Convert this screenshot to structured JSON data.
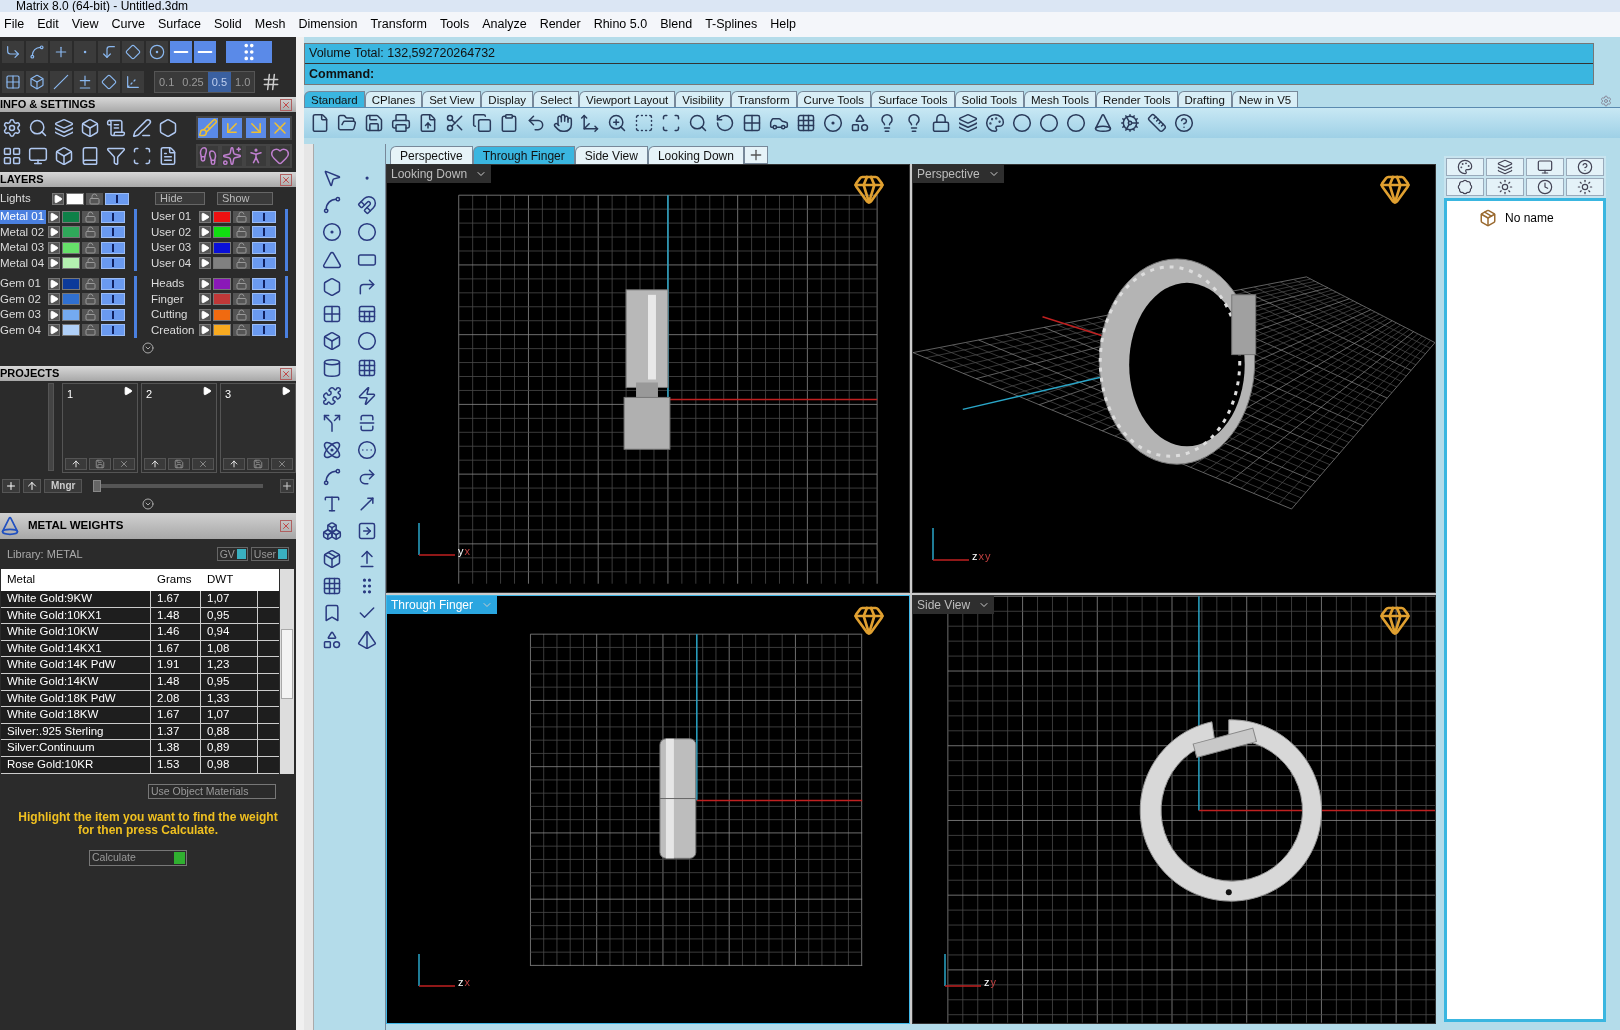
{
  "window": {
    "title": "Matrix 8.0 (64-bit) - Untitled.3dm"
  },
  "menu": [
    "File",
    "Edit",
    "View",
    "Curve",
    "Surface",
    "Solid",
    "Mesh",
    "Dimension",
    "Transform",
    "Tools",
    "Analyze",
    "Render",
    "Rhino 5.0",
    "Blend",
    "T-Splines",
    "Help"
  ],
  "snaps": {
    "grid_steps": [
      {
        "label": "0.1",
        "selected": false
      },
      {
        "label": "0.25",
        "selected": false
      },
      {
        "label": "0.5",
        "selected": true
      },
      {
        "label": "1.0",
        "selected": false
      }
    ]
  },
  "info_settings": {
    "title": "INFO & SETTINGS"
  },
  "layers": {
    "title": "LAYERS",
    "lights": {
      "name": "Lights",
      "color": "#ffffff",
      "visible": true
    },
    "hide": "Hide",
    "show": "Show",
    "groups": [
      [
        {
          "name": "Metal 01",
          "color": "#0e8048",
          "selected": true,
          "visible": true
        },
        {
          "name": "Metal 02",
          "color": "#2fa85a",
          "selected": false,
          "visible": true
        },
        {
          "name": "Metal 03",
          "color": "#66e06a",
          "selected": false,
          "visible": true
        },
        {
          "name": "Metal 04",
          "color": "#b4f0b0",
          "selected": false,
          "visible": true
        }
      ],
      [
        {
          "name": "User 01",
          "color": "#ee1111",
          "selected": false,
          "visible": true
        },
        {
          "name": "User 02",
          "color": "#11dd11",
          "selected": false,
          "visible": true
        },
        {
          "name": "User 03",
          "color": "#0a10d8",
          "selected": false,
          "visible": true
        },
        {
          "name": "User 04",
          "color": "#808080",
          "selected": false,
          "visible": true
        }
      ],
      [
        {
          "name": "Gem 01",
          "color": "#0c3a9a",
          "selected": false,
          "visible": true
        },
        {
          "name": "Gem 02",
          "color": "#3070d0",
          "selected": false,
          "visible": true
        },
        {
          "name": "Gem 03",
          "color": "#74aaf0",
          "selected": false,
          "visible": true
        },
        {
          "name": "Gem 04",
          "color": "#b0d0f8",
          "selected": false,
          "visible": true
        }
      ],
      [
        {
          "name": "Heads",
          "color": "#8a18b8",
          "selected": false,
          "visible": true
        },
        {
          "name": "Finger",
          "color": "#c03838",
          "selected": false,
          "visible": true
        },
        {
          "name": "Cutting",
          "color": "#f06a10",
          "selected": false,
          "visible": true
        },
        {
          "name": "Creation",
          "color": "#f8aa20",
          "selected": false,
          "visible": true
        }
      ]
    ]
  },
  "projects": {
    "title": "PROJECTS",
    "slots": [
      "1",
      "2",
      "3"
    ],
    "manager": "Mngr",
    "slider": {
      "level": 0
    }
  },
  "metal_weights": {
    "title": "METAL WEIGHTS",
    "library": "Library: METAL",
    "toggles": [
      "GV",
      "User"
    ],
    "columns": [
      "Metal",
      "Grams",
      "DWT"
    ],
    "rows": [
      [
        "White Gold:9KW",
        "1.67",
        "1,07"
      ],
      [
        "White Gold:10KX1",
        "1.48",
        "0,95"
      ],
      [
        "White Gold:10KW",
        "1.46",
        "0,94"
      ],
      [
        "White Gold:14KX1",
        "1.67",
        "1,08"
      ],
      [
        "White Gold:14K PdW",
        "1.91",
        "1,23"
      ],
      [
        "White Gold:14KW",
        "1.48",
        "0,95"
      ],
      [
        "White Gold:18K PdW",
        "2.08",
        "1,33"
      ],
      [
        "White Gold:18KW",
        "1.67",
        "1,07"
      ],
      [
        "Silver:.925 Sterling",
        "1.37",
        "0,88"
      ],
      [
        "Silver:Continuum",
        "1.38",
        "0,89"
      ],
      [
        "Rose Gold:10KR",
        "1.53",
        "0,98"
      ]
    ],
    "use_object_materials": "Use Object Materials",
    "hint": "Highlight the item you want to find the weight for then press Calculate.",
    "calculate": "Calculate"
  },
  "command": {
    "volume": "Volume Total: 132,592720264732",
    "prompt": "Command:"
  },
  "toolbar_tabs": [
    {
      "label": "Standard",
      "selected": true
    },
    {
      "label": "CPlanes",
      "selected": false
    },
    {
      "label": "Set View",
      "selected": false
    },
    {
      "label": "Display",
      "selected": false
    },
    {
      "label": "Select",
      "selected": false
    },
    {
      "label": "Viewport Layout",
      "selected": false
    },
    {
      "label": "Visibility",
      "selected": false
    },
    {
      "label": "Transform",
      "selected": false
    },
    {
      "label": "Curve Tools",
      "selected": false
    },
    {
      "label": "Surface Tools",
      "selected": false
    },
    {
      "label": "Solid Tools",
      "selected": false
    },
    {
      "label": "Mesh Tools",
      "selected": false
    },
    {
      "label": "Render Tools",
      "selected": false
    },
    {
      "label": "Drafting",
      "selected": false
    },
    {
      "label": "New in V5",
      "selected": false
    }
  ],
  "viewport_tabs": [
    {
      "label": "Perspective",
      "selected": false
    },
    {
      "label": "Through Finger",
      "selected": true
    },
    {
      "label": "Side View",
      "selected": false
    },
    {
      "label": "Looking Down",
      "selected": false
    }
  ],
  "viewports": [
    {
      "label": "Looking Down",
      "kind": "top",
      "selected": false,
      "axes": [
        "y",
        "x"
      ]
    },
    {
      "label": "Perspective",
      "kind": "perspective",
      "selected": false,
      "axes": [
        "z",
        "x",
        "y"
      ]
    },
    {
      "label": "Through Finger",
      "kind": "front",
      "selected": true,
      "axes": [
        "z",
        "x"
      ]
    },
    {
      "label": "Side View",
      "kind": "side",
      "selected": false,
      "axes": [
        "z",
        "y"
      ]
    }
  ],
  "object_panel": {
    "items": [
      "No name"
    ]
  }
}
